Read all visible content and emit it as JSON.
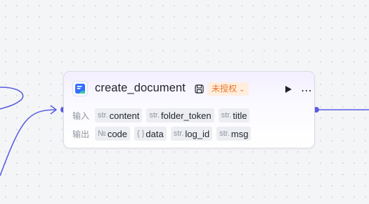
{
  "node": {
    "title": "create_document",
    "badge": "未授权",
    "icons": {
      "app": "doc-app-icon",
      "save": "save-icon",
      "run": "play-icon",
      "more": "more-icon",
      "badge_chevron": "chevron-down-icon"
    },
    "inputs": {
      "label": "输入",
      "params": [
        {
          "type": "str.",
          "name": "content"
        },
        {
          "type": "str.",
          "name": "folder_token"
        },
        {
          "type": "str.",
          "name": "title"
        }
      ]
    },
    "outputs": {
      "label": "输出",
      "params": [
        {
          "type": "№",
          "name": "code"
        },
        {
          "type": "{ }",
          "name": "data"
        },
        {
          "type": "str.",
          "name": "log_id"
        },
        {
          "type": "str.",
          "name": "msg"
        }
      ]
    }
  },
  "colors": {
    "wire": "#5a5fe0",
    "badge_bg": "#ffeede",
    "badge_text": "#e8772b",
    "canvas": "#f4f5f7"
  }
}
